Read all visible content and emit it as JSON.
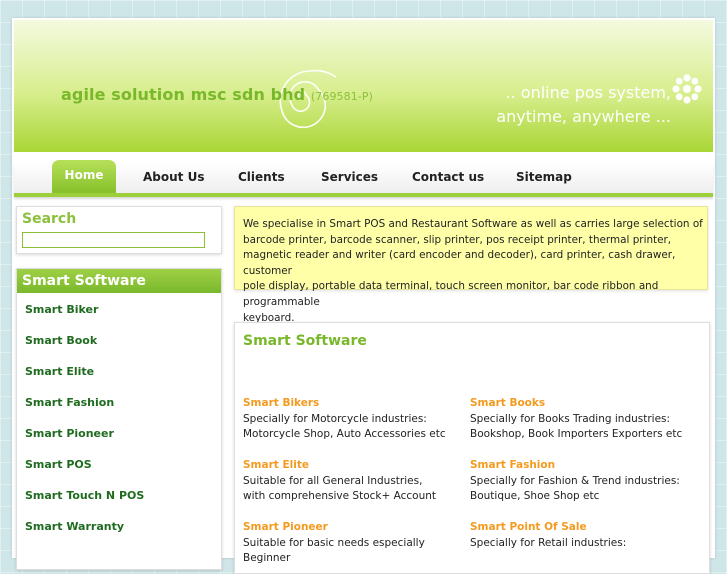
{
  "header": {
    "company": "agile solution msc sdn bhd",
    "reg_no": "(769581-P)",
    "tagline_line1": ".. online pos system,",
    "tagline_line2": "anytime, anywhere ..."
  },
  "nav": {
    "home": "Home",
    "about": "About Us",
    "clients": "Clients",
    "services": "Services",
    "contact": "Contact us",
    "sitemap": "Sitemap"
  },
  "search": {
    "title": "Search",
    "value": ""
  },
  "sidebar": {
    "title": "Smart Software",
    "items": [
      "Smart Biker",
      "Smart Book",
      "Smart Elite",
      "Smart Fashion",
      "Smart Pioneer",
      "Smart POS",
      "Smart Touch N POS",
      "Smart Warranty"
    ]
  },
  "intro": {
    "lines": [
      "We specialise in Smart POS and Restaurant Software as well as carries large selection of",
      "barcode printer, barcode scanner, slip printer, pos receipt printer, thermal printer,",
      "magnetic reader and writer (card encoder and decoder), card printer, cash drawer, customer",
      "pole display, portable data terminal, touch screen monitor, bar code ribbon and programmable",
      "keyboard."
    ]
  },
  "main": {
    "title": "Smart Software",
    "products": [
      {
        "name": "Smart Bikers",
        "line1": "Specially for Motorcycle industries:",
        "line2": "Motorcycle Shop, Auto Accessories etc"
      },
      {
        "name": "Smart Books",
        "line1": "Specially for Books Trading industries:",
        "line2": "Bookshop, Book Importers Exporters etc"
      },
      {
        "name": "Smart Elite",
        "line1": "Suitable for all General Industries,",
        "line2": "with comprehensive Stock+ Account"
      },
      {
        "name": "Smart Fashion",
        "line1": "Specially for Fashion & Trend industries:",
        "line2": "Boutique, Shoe Shop etc"
      },
      {
        "name": "Smart Pioneer",
        "line1": "Suitable for basic needs especially Beginner",
        "line2": ""
      },
      {
        "name": "Smart Point Of Sale",
        "line1": "Specially for Retail industries:",
        "line2": ""
      }
    ]
  },
  "colors": {
    "accent_green": "#79b82a",
    "product_orange": "#f39a1f",
    "intro_bg": "#ffffa8"
  },
  "icons": [
    "swirl-logo-icon",
    "flower-icon"
  ]
}
